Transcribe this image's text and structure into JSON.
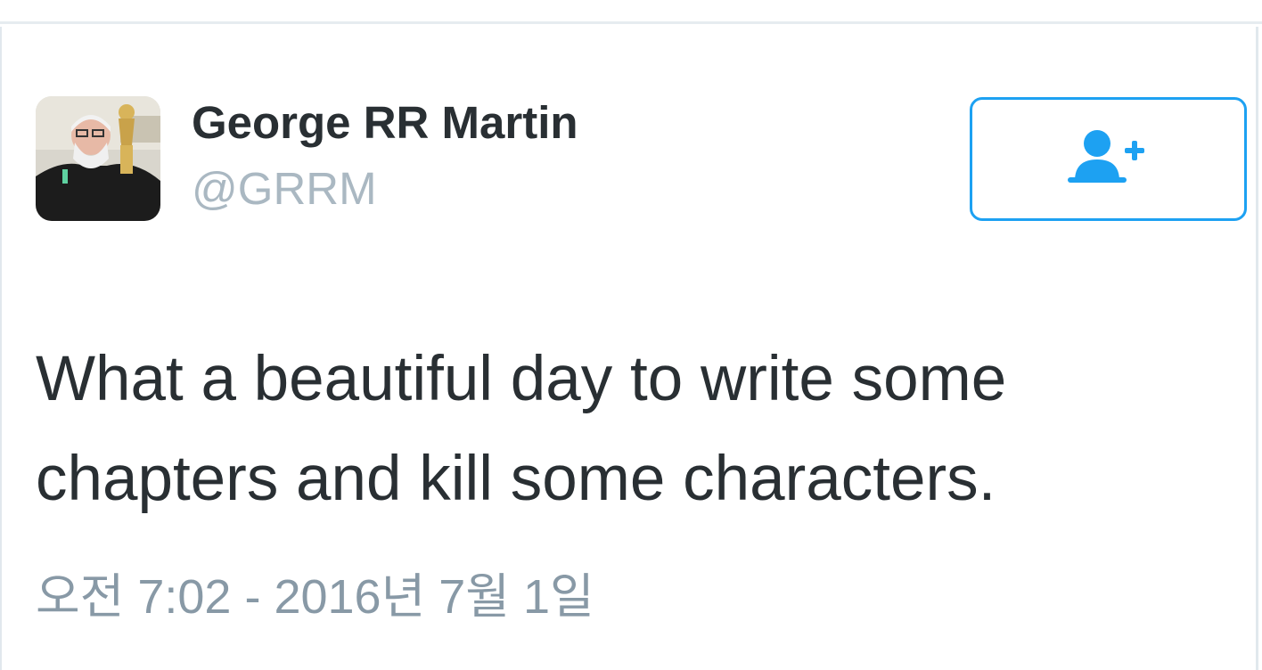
{
  "author": {
    "display_name": "George RR Martin",
    "handle": "@GRRM",
    "avatar_icon": "profile-photo"
  },
  "follow_button": {
    "icon": "follow-user-plus-icon",
    "color": "#1da1f2"
  },
  "tweet": {
    "text_lines": [
      "What a beautiful day to write some",
      "chapters and kill some characters."
    ],
    "timestamp": "오전 7:02 - 2016년 7월 1일"
  },
  "colors": {
    "text": "#292f33",
    "secondary": "#aab8c2",
    "timestamp": "#8899a6",
    "accent": "#1da1f2"
  }
}
